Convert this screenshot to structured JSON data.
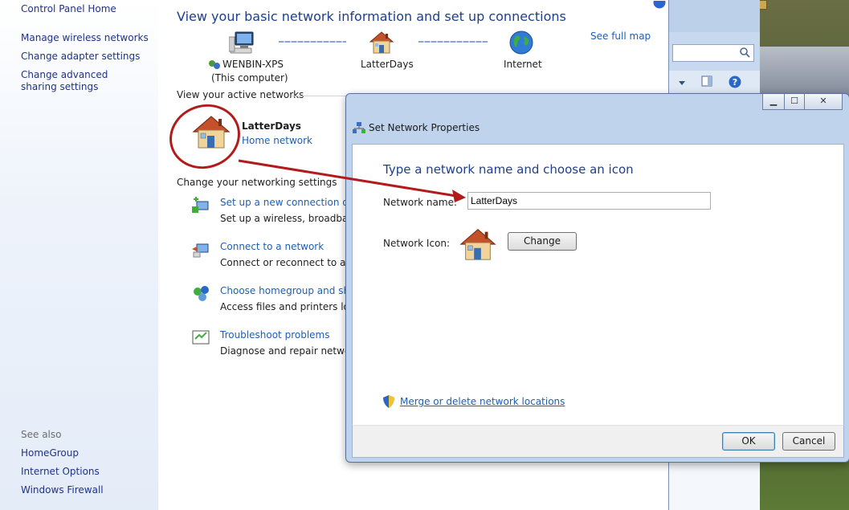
{
  "sidebar": {
    "items": [
      {
        "label": "Control Panel Home"
      },
      {
        "label": "Manage wireless networks"
      },
      {
        "label": "Change adapter settings"
      },
      {
        "label": "Change advanced sharing settings"
      }
    ],
    "see_also_label": "See also",
    "see_also": [
      {
        "label": "HomeGroup"
      },
      {
        "label": "Internet Options"
      },
      {
        "label": "Windows Firewall"
      }
    ]
  },
  "main": {
    "title": "View your basic network information and set up connections",
    "see_full_map": "See full map",
    "map": {
      "computer_name": "WENBIN-XPS",
      "computer_sub": "(This computer)",
      "network_name": "LatterDays",
      "internet": "Internet"
    },
    "active_networks_label": "View your active networks",
    "active_network": {
      "name": "LatterDays",
      "type": "Home network"
    },
    "change_settings_label": "Change your networking settings",
    "tasks": [
      {
        "link": "Set up a new connection or ne",
        "desc": "Set up a wireless, broadband,"
      },
      {
        "link": "Connect to a network",
        "desc": "Connect or reconnect to a wi"
      },
      {
        "link": "Choose homegroup and shari",
        "desc": "Access files and printers locat"
      },
      {
        "link": "Troubleshoot problems",
        "desc": "Diagnose and repair network p"
      }
    ]
  },
  "dialog": {
    "title": "Set Network Properties",
    "heading": "Type a network name and choose an icon",
    "network_name_label": "Network name:",
    "network_name_value": "LatterDays",
    "network_icon_label": "Network Icon:",
    "change_button": "Change",
    "merge_link": "Merge or delete network locations",
    "ok_button": "OK",
    "cancel_button": "Cancel"
  },
  "colors": {
    "link": "#1e5fb3",
    "heading": "#1e3f8b",
    "annotation": "#b21b1b"
  }
}
